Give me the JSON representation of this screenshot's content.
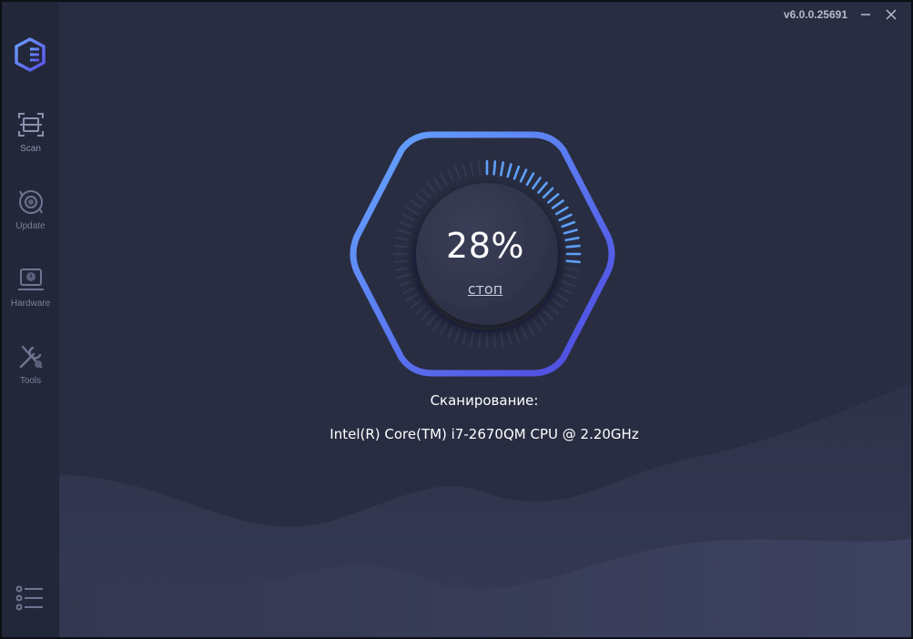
{
  "titlebar": {
    "version": "v6.0.0.25691"
  },
  "sidebar": {
    "items": [
      {
        "label": "Scan",
        "icon": "scan-icon",
        "active": true
      },
      {
        "label": "Update",
        "icon": "update-icon"
      },
      {
        "label": "Hardware",
        "icon": "hardware-icon"
      },
      {
        "label": "Tools",
        "icon": "tools-icon"
      }
    ],
    "menu_icon": "list-menu-icon"
  },
  "progress": {
    "percent_text": "28%",
    "value": 28,
    "stop_label": "стоп"
  },
  "status": {
    "label": "Сканирование:",
    "target": "Intel(R) Core(TM) i7-2670QM CPU @ 2.20GHz"
  },
  "colors": {
    "accent_blue": "#5b8ff5",
    "accent_violet": "#5450e0",
    "background": "#292d42",
    "sidebar": "#23273a"
  }
}
